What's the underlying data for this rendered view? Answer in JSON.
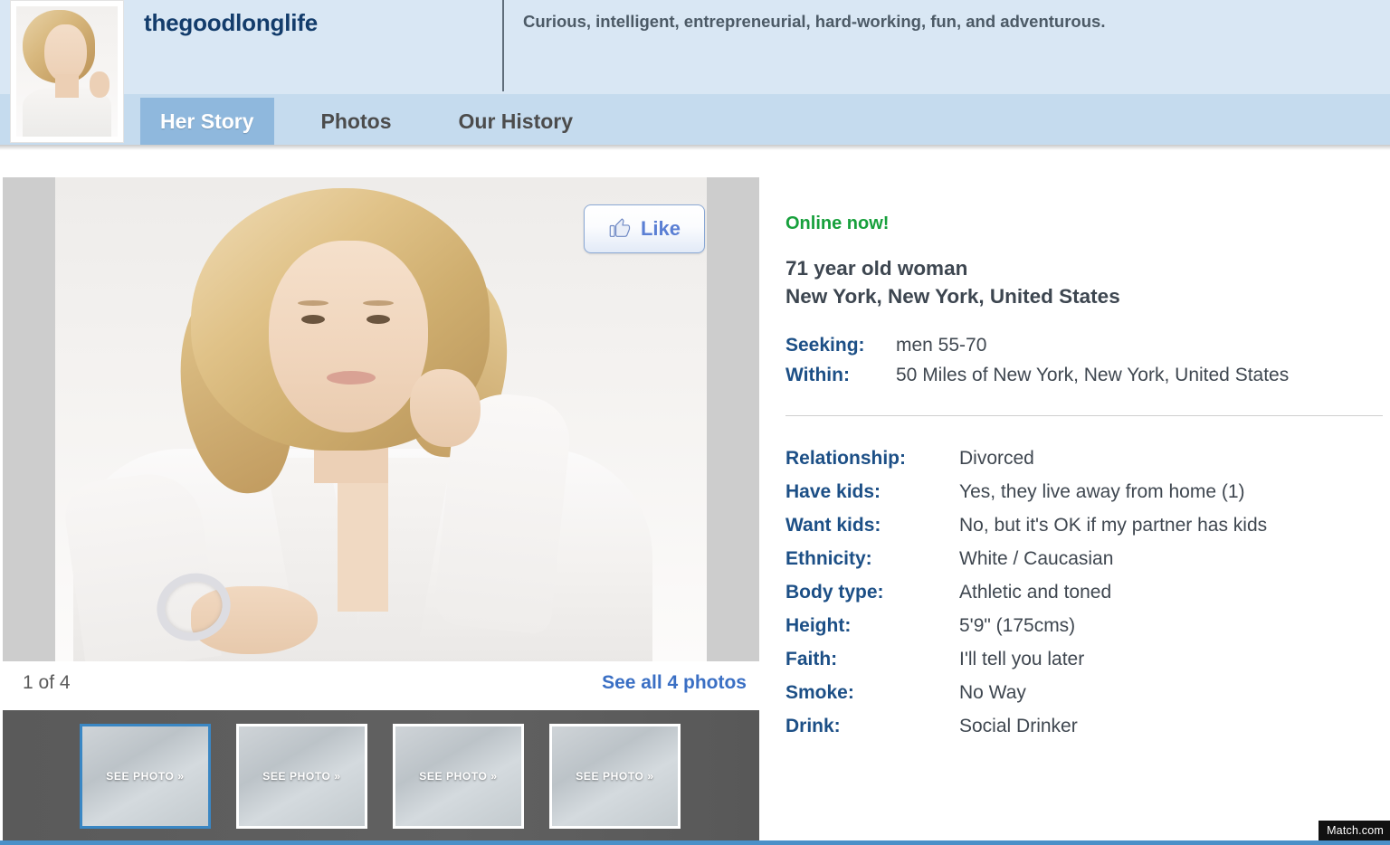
{
  "header": {
    "username": "thegoodlonglife",
    "tagline": "Curious, intelligent, entrepreneurial, hard-working, fun, and adventurous.",
    "avatar_icon": "profile-avatar-photo",
    "tabs": [
      {
        "label": "Her Story",
        "active": true
      },
      {
        "label": "Photos",
        "active": false
      },
      {
        "label": "Our History",
        "active": false
      }
    ]
  },
  "gallery": {
    "like_button": {
      "label": "Like",
      "icon": "thumbs-up-icon"
    },
    "photo_count": "1 of 4",
    "see_all_link": "See all 4 photos",
    "thumbnails": [
      {
        "label": "SEE PHOTO »",
        "selected": true
      },
      {
        "label": "SEE PHOTO »",
        "selected": false
      },
      {
        "label": "SEE PHOTO »",
        "selected": false
      },
      {
        "label": "SEE PHOTO »",
        "selected": false
      }
    ]
  },
  "profile": {
    "status": "Online now!",
    "age_gender": "71 year old woman",
    "location": "New York, New York, United States",
    "preferences": [
      {
        "key": "Seeking:",
        "value": "men 55-70"
      },
      {
        "key": "Within:",
        "value": "50 Miles of New York, New York, United States"
      }
    ],
    "attributes": [
      {
        "key": "Relationship:",
        "value": "Divorced"
      },
      {
        "key": "Have kids:",
        "value": "Yes, they live away from home (1)"
      },
      {
        "key": "Want kids:",
        "value": "No, but it's OK if my partner has kids"
      },
      {
        "key": "Ethnicity:",
        "value": "White / Caucasian"
      },
      {
        "key": "Body type:",
        "value": "Athletic and toned"
      },
      {
        "key": "Height:",
        "value": "5'9\" (175cms)"
      },
      {
        "key": "Faith:",
        "value": "I'll tell you later"
      },
      {
        "key": "Smoke:",
        "value": "No Way"
      },
      {
        "key": "Drink:",
        "value": "Social Drinker"
      }
    ]
  },
  "footer": {
    "watermark": "Match.com"
  },
  "colors": {
    "header_bg": "#d9e7f4",
    "tabbar_bg": "#c5dbee",
    "active_tab_bg": "#8fb8dd",
    "username": "#133c6b",
    "online_green": "#17a03c",
    "label_blue": "#1c4f86",
    "link_blue": "#3a6fc4",
    "thumb_selected_border": "#3a87c4",
    "footer_rule": "#4a90c8"
  }
}
